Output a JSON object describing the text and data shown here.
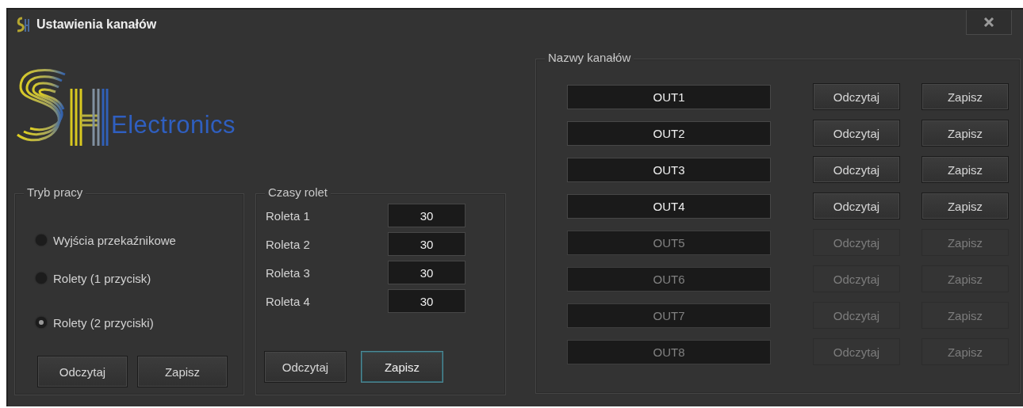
{
  "window": {
    "title": "Ustawienia kanałów"
  },
  "logo": {
    "text": "Electronics"
  },
  "tryb_pracy": {
    "title": "Tryb pracy",
    "options": [
      {
        "label": "Wyjścia przekaźnikowe",
        "selected": false
      },
      {
        "label": "Rolety (1 przycisk)",
        "selected": false
      },
      {
        "label": "Rolety (2 przyciski)",
        "selected": true
      }
    ],
    "buttons": [
      {
        "label": "Odczytaj",
        "focused": false
      },
      {
        "label": "Zapisz",
        "focused": false
      }
    ]
  },
  "czasy_rolet": {
    "title": "Czasy rolet",
    "rows": [
      {
        "label": "Roleta 1",
        "value": "30"
      },
      {
        "label": "Roleta 2",
        "value": "30"
      },
      {
        "label": "Roleta 3",
        "value": "30"
      },
      {
        "label": "Roleta 4",
        "value": "30"
      }
    ],
    "buttons": [
      {
        "label": "Odczytaj",
        "focused": false
      },
      {
        "label": "Zapisz",
        "focused": true
      }
    ]
  },
  "nazwy_kanalow": {
    "title": "Nazwy kanałów",
    "channels": [
      {
        "name": "OUT1",
        "disabled": false,
        "read": "Odczytaj",
        "write": "Zapisz"
      },
      {
        "name": "OUT2",
        "disabled": false,
        "read": "Odczytaj",
        "write": "Zapisz"
      },
      {
        "name": "OUT3",
        "disabled": false,
        "read": "Odczytaj",
        "write": "Zapisz"
      },
      {
        "name": "OUT4",
        "disabled": false,
        "read": "Odczytaj",
        "write": "Zapisz"
      },
      {
        "name": "OUT5",
        "disabled": true,
        "read": "Odczytaj",
        "write": "Zapisz"
      },
      {
        "name": "OUT6",
        "disabled": true,
        "read": "Odczytaj",
        "write": "Zapisz"
      },
      {
        "name": "OUT7",
        "disabled": true,
        "read": "Odczytaj",
        "write": "Zapisz"
      },
      {
        "name": "OUT8",
        "disabled": true,
        "read": "Odczytaj",
        "write": "Zapisz"
      }
    ]
  }
}
